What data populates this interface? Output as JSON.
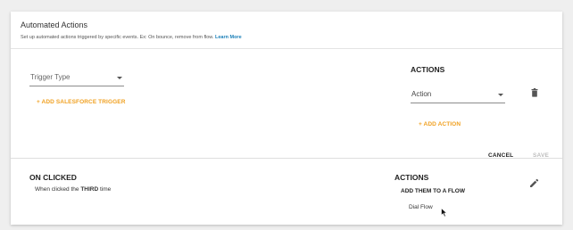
{
  "header": {
    "title": "Automated Actions",
    "subtitle": "Set up automated actions triggered by specific events. Ex: On bounce, remove from flow.",
    "learn_more": "Learn More"
  },
  "editor": {
    "trigger_placeholder": "Trigger Type",
    "add_trigger": "+ ADD SALESFORCE TRIGGER",
    "actions_heading": "ACTIONS",
    "action_placeholder": "Action",
    "add_action": "+ ADD ACTION",
    "cancel": "CANCEL",
    "save": "SAVE"
  },
  "rule": {
    "trigger_title": "ON CLICKED",
    "desc_prefix": "When clicked the ",
    "desc_bold": "THIRD",
    "desc_suffix": " time",
    "actions_heading": "ACTIONS",
    "action_title": "ADD THEM TO A FLOW",
    "flow_name": "Dial Flow"
  },
  "icons": {
    "trash": "trash-icon",
    "edit": "pencil-icon",
    "caret": "caret-down-icon",
    "cursor": "mouse-pointer-icon"
  },
  "colors": {
    "accent": "#f0a020",
    "link": "#1a7fb8",
    "disabled": "#bdbdbd"
  }
}
